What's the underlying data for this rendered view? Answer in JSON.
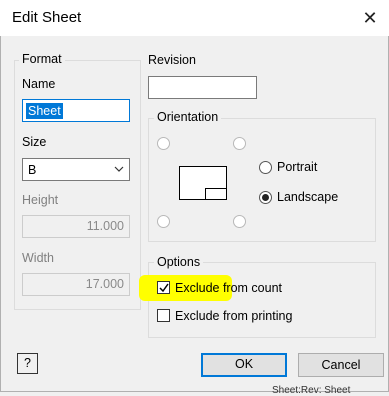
{
  "window": {
    "title": "Edit Sheet",
    "close_glyph": "✕"
  },
  "format": {
    "group_label": "Format",
    "name_label": "Name",
    "name_value": "Sheet",
    "size_label": "Size",
    "size_value": "B",
    "height_label": "Height",
    "height_value": "11.000",
    "width_label": "Width",
    "width_value": "17.000"
  },
  "revision": {
    "label": "Revision",
    "value": ""
  },
  "orientation": {
    "group_label": "Orientation",
    "portrait_label": "Portrait",
    "landscape_label": "Landscape",
    "selected": "Landscape"
  },
  "options": {
    "group_label": "Options",
    "exclude_count_label": "Exclude from count",
    "exclude_count_checked": true,
    "exclude_printing_label": "Exclude from printing",
    "exclude_printing_checked": false,
    "highlight_color": "#ffff00"
  },
  "buttons": {
    "help_glyph": "?",
    "ok": "OK",
    "cancel": "Cancel"
  },
  "background_text": "Sheet:Rev: Sheet"
}
